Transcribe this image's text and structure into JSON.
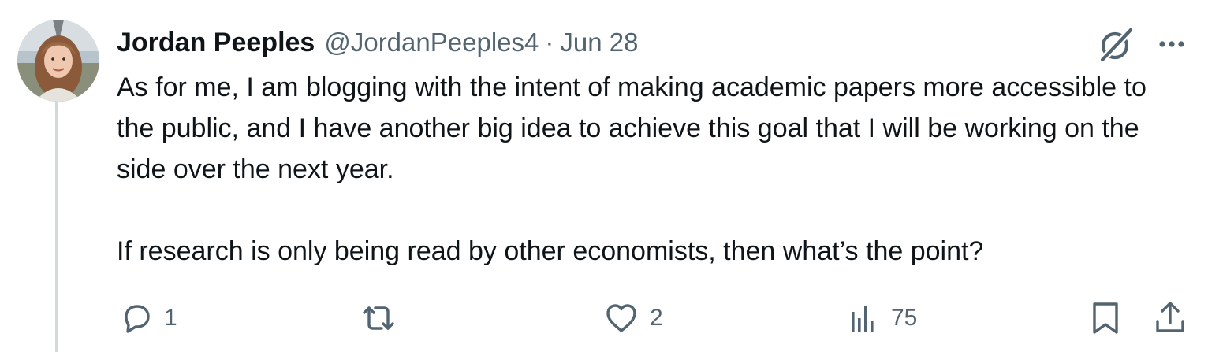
{
  "tweet": {
    "author_name": "Jordan Peeples",
    "handle": "@JordanPeeples4",
    "separator": "·",
    "date": "Jun 28",
    "paragraphs": [
      "As for me, I am blogging with the intent of making academic papers more accessible to the public, and I have another big idea to achieve this goal that I will be working on the side over the next year.",
      "If research is only being read by other economists, then what’s the point?"
    ],
    "avatar_icon": "user-avatar-photo"
  },
  "top_actions": {
    "grok_icon": "grok-icon",
    "more_icon": "more-dots-icon"
  },
  "actions": {
    "reply": {
      "icon": "reply-icon",
      "count": "1"
    },
    "retweet": {
      "icon": "retweet-icon",
      "count": ""
    },
    "like": {
      "icon": "heart-icon",
      "count": "2"
    },
    "views": {
      "icon": "views-icon",
      "count": "75"
    },
    "bookmark": {
      "icon": "bookmark-icon"
    },
    "share": {
      "icon": "share-icon"
    }
  },
  "colors": {
    "text": "#0f1419",
    "secondary": "#536471",
    "thread_line": "#cfd9de",
    "background": "#ffffff"
  }
}
